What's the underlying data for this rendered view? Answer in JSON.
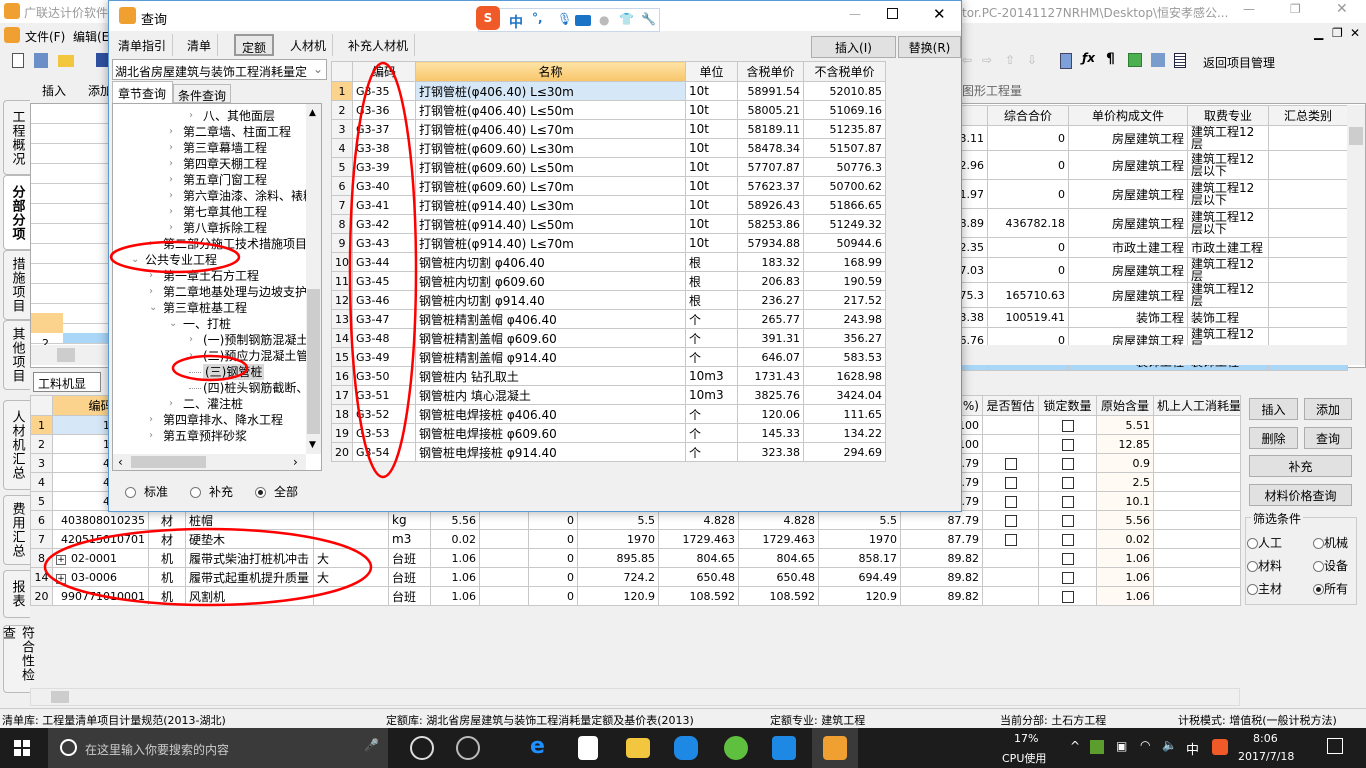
{
  "main": {
    "title": "广联达计价软件",
    "path_title": "tor.PC-20141127NRHM\\Desktop\\恒安孝感公...",
    "menu": [
      "文件(F)",
      "编辑(E)"
    ],
    "toolbar2": [
      "插入",
      "添加"
    ],
    "return_label": "返回项目管理",
    "graphic_tab": "图形工程量",
    "vtabs": [
      "工程概况",
      "分部分项",
      "措施项目",
      "其他项目",
      "人材机汇总",
      "费用汇总",
      "报表",
      "符合性检查"
    ],
    "upper_headers": [
      "价",
      "综合合价",
      "单价构成文件",
      "取费专业",
      "汇总类别"
    ],
    "upper_rows": [
      [
        "3.11",
        "0",
        "房屋建筑工程",
        "建筑工程12层",
        ""
      ],
      [
        "2.96",
        "0",
        "房屋建筑工程",
        "建筑工程12层以下",
        ""
      ],
      [
        "1.97",
        "0",
        "房屋建筑工程",
        "建筑工程12层以下",
        ""
      ],
      [
        "8.89",
        "436782.18",
        "房屋建筑工程",
        "建筑工程12层以下",
        ""
      ],
      [
        "2.35",
        "0",
        "市政土建工程",
        "市政土建工程",
        ""
      ],
      [
        "7.03",
        "0",
        "房屋建筑工程",
        "建筑工程12层",
        ""
      ],
      [
        "75.3",
        "165710.63",
        "房屋建筑工程",
        "建筑工程12层",
        ""
      ],
      [
        "3.38",
        "100519.41",
        "装饰工程",
        "装饰工程",
        ""
      ],
      [
        "6.76",
        "0",
        "房屋建筑工程",
        "建筑工程12层",
        ""
      ],
      [
        "1.53",
        "5401.53",
        "装饰工程",
        "装饰工程",
        ""
      ]
    ],
    "upper_left_rownum": "2",
    "glj_tab": "工料机显示",
    "lower_headers": {
      "code": "编码",
      "pct": "%)",
      "est": "是否暂估",
      "lock": "锁定数量",
      "orig": "原始含量",
      "machine": "机上人工消耗量"
    },
    "lower_rows": [
      {
        "n": "1",
        "code": "100000",
        "type": "",
        "name": "",
        "spec": "",
        "unit": "",
        "qty": "",
        "v1": "",
        "v2": "",
        "v3": "",
        "v4": "",
        "v5": "",
        "v6": "100",
        "est": false,
        "orig": "5.51"
      },
      {
        "n": "2",
        "code": "100000",
        "type": "",
        "name": "",
        "spec": "",
        "unit": "",
        "qty": "",
        "v1": "",
        "v2": "",
        "v3": "",
        "v4": "",
        "v5": "",
        "v6": "100",
        "est": false,
        "orig": "12.85"
      },
      {
        "n": "3",
        "code": "402505",
        "type": "",
        "name": "",
        "spec": "",
        "unit": "",
        "qty": "",
        "v1": "",
        "v2": "",
        "v3": "",
        "v4": "",
        "v5": "",
        "v6": "87.79",
        "est": true,
        "orig": "0.9"
      },
      {
        "n": "4",
        "code": "402509",
        "type": "",
        "name": "",
        "spec": "",
        "unit": "",
        "qty": "",
        "v1": "",
        "v2": "",
        "v3": "",
        "v4": "",
        "v5": "",
        "v6": "87.79",
        "est": true,
        "orig": "2.5"
      },
      {
        "n": "5",
        "code": "403808",
        "type": "",
        "name": "",
        "spec": "",
        "unit": "",
        "qty": "",
        "v1": "",
        "v2": "",
        "v3": "",
        "v4": "",
        "v5": "",
        "v6": "87.79",
        "est": true,
        "orig": "10.1"
      },
      {
        "n": "6",
        "code": "403808010235",
        "type": "材",
        "name": "桩帽",
        "spec": "",
        "unit": "kg",
        "qty": "5.56",
        "v1": "0",
        "v2": "5.5",
        "v3": "4.828",
        "v4": "4.828",
        "v5": "5.5",
        "v6": "87.79",
        "est": true,
        "orig": "5.56"
      },
      {
        "n": "7",
        "code": "420515010701",
        "type": "材",
        "name": "硬垫木",
        "spec": "",
        "unit": "m3",
        "qty": "0.02",
        "v1": "0",
        "v2": "1970",
        "v3": "1729.463",
        "v4": "1729.463",
        "v5": "1970",
        "v6": "87.79",
        "est": true,
        "orig": "0.02"
      },
      {
        "n": "8",
        "code": "02-0001",
        "expand": true,
        "type": "机",
        "name": "履带式柴油打桩机冲击",
        "spec": "大",
        "unit": "台班",
        "qty": "1.06",
        "v1": "0",
        "v2": "895.85",
        "v3": "804.65",
        "v4": "804.65",
        "v5": "858.17",
        "v6": "89.82",
        "est": false,
        "orig": "1.06"
      },
      {
        "n": "14",
        "code": "03-0006",
        "expand": true,
        "type": "机",
        "name": "履带式起重机提升质量",
        "spec": "大",
        "unit": "台班",
        "qty": "1.06",
        "v1": "0",
        "v2": "724.2",
        "v3": "650.48",
        "v4": "650.48",
        "v5": "694.49",
        "v6": "89.82",
        "est": false,
        "orig": "1.06"
      },
      {
        "n": "20",
        "code": "990771010001",
        "type": "机",
        "name": "风割机",
        "spec": "",
        "unit": "台班",
        "qty": "1.06",
        "v1": "0",
        "v2": "120.9",
        "v3": "108.592",
        "v4": "108.592",
        "v5": "120.9",
        "v6": "89.82",
        "est": false,
        "orig": "1.06"
      }
    ],
    "side_buttons": {
      "insert": "插入",
      "add": "添加",
      "delete": "删除",
      "query": "查询",
      "supplement": "补充",
      "price_query": "材料价格查询"
    },
    "filter": {
      "title": "筛选条件",
      "options": [
        {
          "label": "人工",
          "on": false
        },
        {
          "label": "机械",
          "on": false
        },
        {
          "label": "材料",
          "on": false
        },
        {
          "label": "设备",
          "on": false
        },
        {
          "label": "主材",
          "on": false
        },
        {
          "label": "所有",
          "on": true
        }
      ]
    },
    "status": [
      "清单库: 工程量清单项目计量规范(2013-湖北)",
      "定额库: 湖北省房屋建筑与装饰工程消耗量定额及基价表(2013)",
      "定额专业: 建筑工程",
      "当前分部: 土石方工程",
      "计税模式: 增值税(一般计税方法)"
    ]
  },
  "dialog": {
    "title": "查询",
    "tabs": [
      "清单指引",
      "清单",
      "定额",
      "人材机",
      "补充人材机"
    ],
    "active_tab": "定额",
    "insert_button": "插入(I)",
    "replace_button": "替换(R)",
    "library_select": "湖北省房屋建筑与装饰工程消耗量定",
    "search_tabs": [
      "章节查询",
      "条件查询"
    ],
    "tree": [
      {
        "label": "八、其他面层",
        "level": 3,
        "arrow": "right"
      },
      {
        "label": "第二章墙、柱面工程",
        "level": 2,
        "arrow": "right"
      },
      {
        "label": "第三章幕墙工程",
        "level": 2,
        "arrow": "right"
      },
      {
        "label": "第四章天棚工程",
        "level": 2,
        "arrow": "right"
      },
      {
        "label": "第五章门窗工程",
        "level": 2,
        "arrow": "right"
      },
      {
        "label": "第六章油漆、涂料、裱糊",
        "level": 2,
        "arrow": "right"
      },
      {
        "label": "第七章其他工程",
        "level": 2,
        "arrow": "right"
      },
      {
        "label": "第八章拆除工程",
        "level": 2,
        "arrow": "right"
      },
      {
        "label": "第二部分施工技术措施项目",
        "level": 1,
        "arrow": "right"
      },
      {
        "label": "公共专业工程",
        "level": 0,
        "arrow": "down"
      },
      {
        "label": "第一章土石方工程",
        "level": 1,
        "arrow": "right"
      },
      {
        "label": "第二章地基处理与边坡支护",
        "level": 1,
        "arrow": "right"
      },
      {
        "label": "第三章桩基工程",
        "level": 1,
        "arrow": "down"
      },
      {
        "label": "一、打桩",
        "level": 2,
        "arrow": "down"
      },
      {
        "label": "(一)预制钢筋混凝土",
        "level": 3,
        "arrow": "right"
      },
      {
        "label": "(二)预应力混凝土管",
        "level": 3,
        "arrow": "right"
      },
      {
        "label": "(三)钢管桩",
        "level": 3,
        "arrow": "none",
        "selected": true
      },
      {
        "label": "(四)桩头钢筋截断、",
        "level": 3,
        "arrow": "none"
      },
      {
        "label": "二、灌注桩",
        "level": 2,
        "arrow": "right"
      },
      {
        "label": "第四章排水、降水工程",
        "level": 1,
        "arrow": "right"
      },
      {
        "label": "第五章预拌砂浆",
        "level": 1,
        "arrow": "right"
      }
    ],
    "radios": [
      {
        "label": "标准",
        "on": false
      },
      {
        "label": "补充",
        "on": false
      },
      {
        "label": "全部",
        "on": true
      }
    ],
    "table_headers": [
      "",
      "编码",
      "名称",
      "单位",
      "含税单价",
      "不含税单价"
    ],
    "rows": [
      [
        "1",
        "G3-35",
        "打钢管桩(φ406.40) L≤30m",
        "10t",
        "58991.54",
        "52010.85"
      ],
      [
        "2",
        "G3-36",
        "打钢管桩(φ406.40) L≤50m",
        "10t",
        "58005.21",
        "51069.16"
      ],
      [
        "3",
        "G3-37",
        "打钢管桩(φ406.40) L≤70m",
        "10t",
        "58189.11",
        "51235.87"
      ],
      [
        "4",
        "G3-38",
        "打钢管桩(φ609.60) L≤30m",
        "10t",
        "58478.34",
        "51507.87"
      ],
      [
        "5",
        "G3-39",
        "打钢管桩(φ609.60) L≤50m",
        "10t",
        "57707.87",
        "50776.3"
      ],
      [
        "6",
        "G3-40",
        "打钢管桩(φ609.60) L≤70m",
        "10t",
        "57623.37",
        "50700.62"
      ],
      [
        "7",
        "G3-41",
        "打钢管桩(φ914.40) L≤30m",
        "10t",
        "58926.43",
        "51866.65"
      ],
      [
        "8",
        "G3-42",
        "打钢管桩(φ914.40) L≤50m",
        "10t",
        "58253.86",
        "51249.32"
      ],
      [
        "9",
        "G3-43",
        "打钢管桩(φ914.40) L≤70m",
        "10t",
        "57934.88",
        "50944.6"
      ],
      [
        "10",
        "G3-44",
        "钢管桩内切割 φ406.40",
        "根",
        "183.32",
        "168.99"
      ],
      [
        "11",
        "G3-45",
        "钢管桩内切割 φ609.60",
        "根",
        "206.83",
        "190.59"
      ],
      [
        "12",
        "G3-46",
        "钢管桩内切割 φ914.40",
        "根",
        "236.27",
        "217.52"
      ],
      [
        "13",
        "G3-47",
        "钢管桩精割盖帽 φ406.40",
        "个",
        "265.77",
        "243.98"
      ],
      [
        "14",
        "G3-48",
        "钢管桩精割盖帽 φ609.60",
        "个",
        "391.31",
        "356.27"
      ],
      [
        "15",
        "G3-49",
        "钢管桩精割盖帽 φ914.40",
        "个",
        "646.07",
        "583.53"
      ],
      [
        "16",
        "G3-50",
        "钢管桩内 钻孔取土",
        "10m3",
        "1731.43",
        "1628.98"
      ],
      [
        "17",
        "G3-51",
        "钢管桩内 填心混凝土",
        "10m3",
        "3825.76",
        "3424.04"
      ],
      [
        "18",
        "G3-52",
        "钢管桩电焊接桩 φ406.40",
        "个",
        "120.06",
        "111.65"
      ],
      [
        "19",
        "G3-53",
        "钢管桩电焊接桩 φ609.60",
        "个",
        "145.33",
        "134.22"
      ],
      [
        "20",
        "G3-54",
        "钢管桩电焊接桩 φ914.40",
        "个",
        "323.38",
        "294.69"
      ]
    ]
  },
  "ime": {
    "lang": "中",
    "punct": "°,"
  },
  "taskbar": {
    "search_placeholder": "在这里输入你要搜索的内容",
    "cpu_pct": "17%",
    "cpu_label": "CPU使用",
    "ime": "中",
    "time": "8:06",
    "date": "2017/7/18"
  },
  "colors": {
    "header_orange": "#fcd38c",
    "selected_blue": "#d6e8f8",
    "annotation_red": "#ff0000",
    "taskbar": "#1c1c1c"
  }
}
